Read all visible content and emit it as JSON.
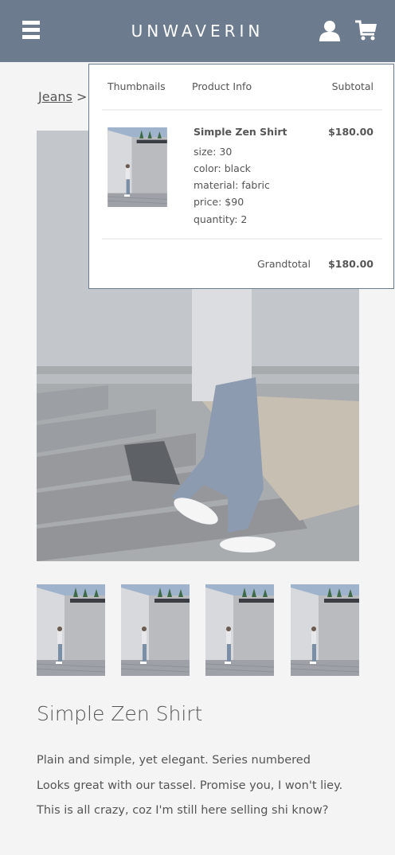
{
  "header": {
    "brand": "UNWAVERIN",
    "icons": [
      "menu-icon",
      "user-icon",
      "cart-icon"
    ],
    "background_color": "#6d7b8f"
  },
  "breadcrumb": {
    "link": "Jeans",
    "separator": ">"
  },
  "product": {
    "title": "Simple Zen Shirt",
    "description_lines": [
      "Plain and simple, yet elegant. Series numbered",
      "Looks great with our tassel. Promise you, I won't liey.",
      "This is all crazy, coz I'm still here selling shi know?"
    ]
  },
  "cart": {
    "columns": [
      "Thumbnails",
      "Product Info",
      "Subtotal"
    ],
    "item": {
      "name": "Simple Zen Shirt",
      "attributes": [
        "size: 30",
        "color: black",
        "material: fabric",
        "price: $90",
        "quantity: 2"
      ],
      "subtotal": "$180.00"
    },
    "grandtotal_label": "Grandtotal",
    "grandtotal_value": "$180.00"
  }
}
